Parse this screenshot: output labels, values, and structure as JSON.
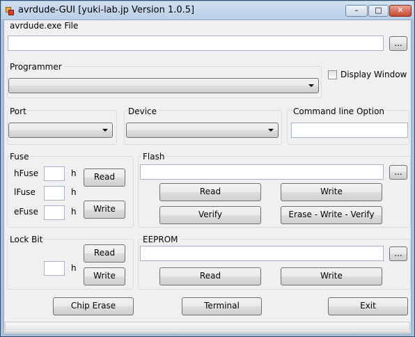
{
  "window": {
    "title": "avrdude-GUI [yuki-lab.jp Version 1.0.5]",
    "minimize_glyph": "–",
    "maximize_glyph": "□",
    "close_glyph": "✕"
  },
  "avrdude_file": {
    "label": "avrdude.exe File",
    "value": "",
    "browse_label": "..."
  },
  "programmer": {
    "label": "Programmer",
    "selected": ""
  },
  "display_window": {
    "label": "Display Window",
    "checked": false
  },
  "port": {
    "label": "Port",
    "selected": ""
  },
  "device": {
    "label": "Device",
    "selected": ""
  },
  "command_line": {
    "label": "Command line Option",
    "value": ""
  },
  "fuse": {
    "label": "Fuse",
    "hfuse_label": "hFuse",
    "lfuse_label": "lFuse",
    "efuse_label": "eFuse",
    "hex_suffix": "h",
    "hfuse_value": "",
    "lfuse_value": "",
    "efuse_value": "",
    "read_label": "Read",
    "write_label": "Write"
  },
  "flash": {
    "label": "Flash",
    "value": "",
    "browse_label": "...",
    "read_label": "Read",
    "write_label": "Write",
    "verify_label": "Verify",
    "erase_write_verify_label": "Erase - Write - Verify"
  },
  "lock_bit": {
    "label": "Lock Bit",
    "value": "",
    "hex_suffix": "h",
    "read_label": "Read",
    "write_label": "Write"
  },
  "eeprom": {
    "label": "EEPROM",
    "value": "",
    "browse_label": "...",
    "read_label": "Read",
    "write_label": "Write"
  },
  "bottom": {
    "chip_erase_label": "Chip Erase",
    "terminal_label": "Terminal",
    "exit_label": "Exit"
  },
  "status": {
    "text": ""
  }
}
